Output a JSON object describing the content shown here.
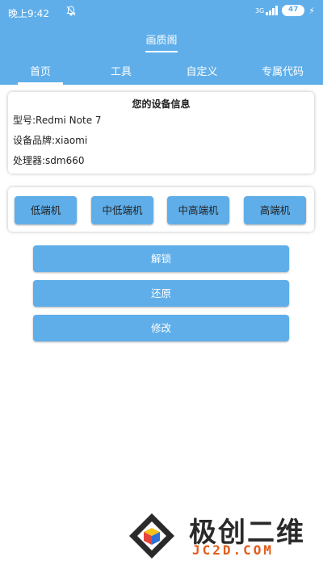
{
  "status_bar": {
    "time": "晚上9:42",
    "network": "3G",
    "battery": "47"
  },
  "header": {
    "title": "画质阁"
  },
  "tabs": [
    {
      "label": "首页",
      "active": true
    },
    {
      "label": "工具",
      "active": false
    },
    {
      "label": "自定义",
      "active": false
    },
    {
      "label": "专属代码",
      "active": false
    }
  ],
  "device_info": {
    "title": "您的设备信息",
    "model": "型号:Redmi Note 7",
    "brand": "设备品牌:xiaomi",
    "processor": "处理器:sdm660"
  },
  "tiers": [
    {
      "label": "低端机"
    },
    {
      "label": "中低端机"
    },
    {
      "label": "中高端机"
    },
    {
      "label": "高端机"
    }
  ],
  "actions": [
    {
      "label": "解锁"
    },
    {
      "label": "还原"
    },
    {
      "label": "修改"
    }
  ],
  "watermark": {
    "title": "极创二维",
    "url": "JC2D.COM"
  },
  "colors": {
    "accent": "#5faee9",
    "watermark_orange": "#e35b1a"
  }
}
